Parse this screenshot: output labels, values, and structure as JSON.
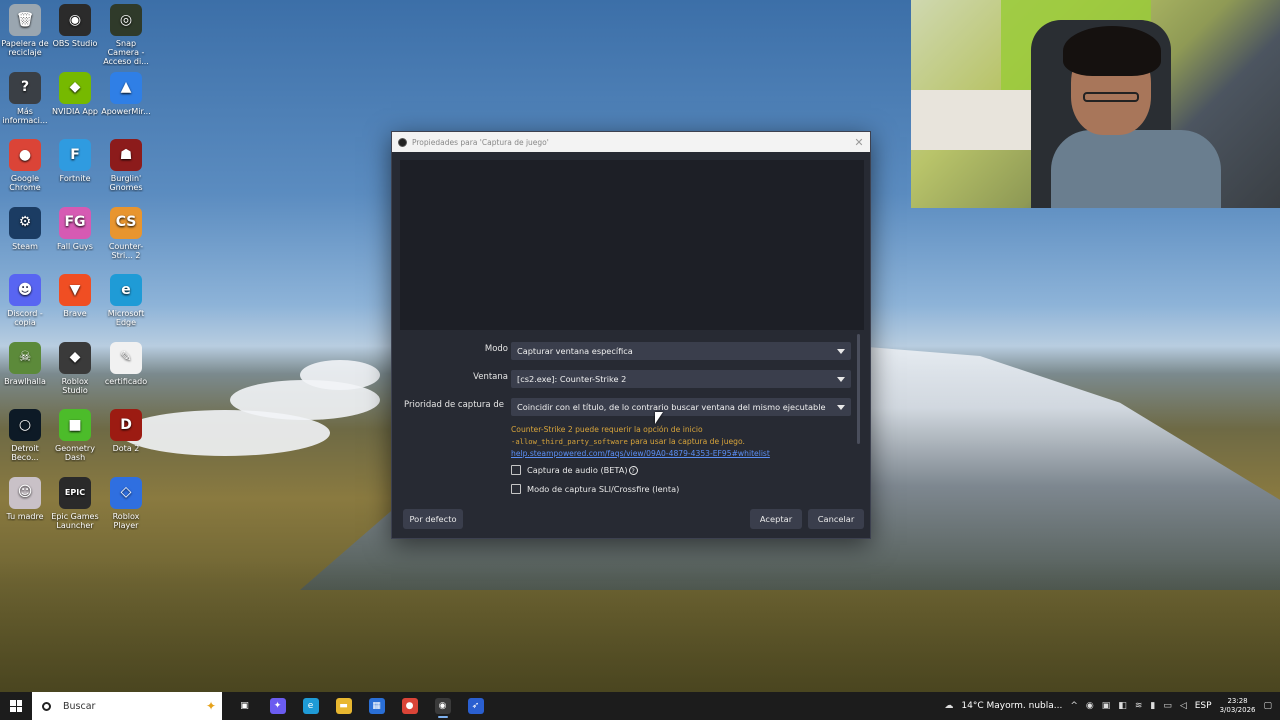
{
  "desktop": {
    "icons": [
      {
        "label": "Papelera de reciclaje",
        "icon": "recycle-bin-icon",
        "color": "#9aa6b0",
        "glyph": "🗑"
      },
      {
        "label": "OBS Studio",
        "icon": "obs-studio-icon",
        "color": "#2b2b2b",
        "glyph": "◉"
      },
      {
        "label": "Snap Camera - Acceso di...",
        "icon": "snap-camera-icon",
        "color": "#2f3a2a",
        "glyph": "◎"
      },
      {
        "label": "Más informaci...",
        "icon": "info-icon",
        "color": "#3a3f45",
        "glyph": "?"
      },
      {
        "label": "NVIDIA App",
        "icon": "nvidia-icon",
        "color": "#76b900",
        "glyph": "◆"
      },
      {
        "label": "ApowerMir...",
        "icon": "apowermirror-icon",
        "color": "#2f7fe6",
        "glyph": "▲"
      },
      {
        "label": "Google Chrome",
        "icon": "chrome-icon",
        "color": "#db4437",
        "glyph": "●"
      },
      {
        "label": "Fortnite",
        "icon": "fortnite-icon",
        "color": "#2f9be0",
        "glyph": "F"
      },
      {
        "label": "Burglin' Gnomes",
        "icon": "burglin-gnomes-icon",
        "color": "#8c1b1b",
        "glyph": "☗"
      },
      {
        "label": "Steam",
        "icon": "steam-icon",
        "color": "#1b3c63",
        "glyph": "⚙"
      },
      {
        "label": "Fall Guys",
        "icon": "fall-guys-icon",
        "color": "#d65ab3",
        "glyph": "FG"
      },
      {
        "label": "Counter-Stri... 2",
        "icon": "counter-strike-icon",
        "color": "#e8952f",
        "glyph": "CS"
      },
      {
        "label": "Discord - copia",
        "icon": "discord-icon",
        "color": "#5865f2",
        "glyph": "☻"
      },
      {
        "label": "Brave",
        "icon": "brave-icon",
        "color": "#f04e23",
        "glyph": "▼"
      },
      {
        "label": "Microsoft Edge",
        "icon": "edge-icon",
        "color": "#1f9bd6",
        "glyph": "e"
      },
      {
        "label": "Brawlhalla",
        "icon": "brawlhalla-icon",
        "color": "#5c8a3a",
        "glyph": "☠"
      },
      {
        "label": "Roblox Studio",
        "icon": "roblox-studio-icon",
        "color": "#3a3a3a",
        "glyph": "◆"
      },
      {
        "label": "certificado",
        "icon": "certificate-icon",
        "color": "#f1f1f1",
        "glyph": "✎"
      },
      {
        "label": "Detroit Beco...",
        "icon": "detroit-icon",
        "color": "#0d1a26",
        "glyph": "○"
      },
      {
        "label": "Geometry Dash",
        "icon": "geometry-dash-icon",
        "color": "#4cbc2a",
        "glyph": "■"
      },
      {
        "label": "Dota 2",
        "icon": "dota2-icon",
        "color": "#9c1b12",
        "glyph": "D"
      },
      {
        "label": "Tu madre",
        "icon": "picture-icon",
        "color": "#c9c1c7",
        "glyph": "☺"
      },
      {
        "label": "Epic Games Launcher",
        "icon": "epic-games-icon",
        "color": "#2a2a2a",
        "glyph": "EPIC"
      },
      {
        "label": "Roblox Player",
        "icon": "roblox-player-icon",
        "color": "#2f6fe0",
        "glyph": "◇"
      }
    ]
  },
  "dialog": {
    "title": "Propiedades para 'Captura de juego'",
    "close_glyph": "✕",
    "mode_label": "Modo",
    "mode_value": "Capturar ventana específica",
    "window_label": "Ventana",
    "window_value": "[cs2.exe]: Counter-Strike 2",
    "priority_label": "Prioridad de captura de ve",
    "priority_value": "Coincidir con el título, de lo contrario buscar ventana del mismo ejecutable",
    "warning_line1": "Counter-Strike 2 puede requerir la opción de inicio",
    "warning_code": "-allow_third_party_software",
    "warning_line2": " para usar la captura de juego.",
    "warning_link": "help.steampowered.com/faqs/view/09A0-4879-4353-EF95#whitelist",
    "audio_capture_label": "Captura de audio (BETA)",
    "help_glyph": "?",
    "sli_label": "Modo de captura SLI/Crossfire (lenta)",
    "defaults_button": "Por defecto",
    "ok_button": "Aceptar",
    "cancel_button": "Cancelar"
  },
  "taskbar": {
    "search_placeholder": "Buscar",
    "apps": [
      {
        "name": "task-view-icon",
        "glyph": "▣",
        "color": "#1c1c1c"
      },
      {
        "name": "copilot-icon",
        "glyph": "✦",
        "color": "#6b5cf0"
      },
      {
        "name": "edge-taskbar-icon",
        "glyph": "e",
        "color": "#1f9bd6"
      },
      {
        "name": "file-explorer-icon",
        "glyph": "▬",
        "color": "#e8b730"
      },
      {
        "name": "store-icon",
        "glyph": "▦",
        "color": "#2a6fd6"
      },
      {
        "name": "chrome-taskbar-icon",
        "glyph": "●",
        "color": "#db4437"
      },
      {
        "name": "obs-taskbar-icon",
        "glyph": "◉",
        "color": "#3a3a3a"
      },
      {
        "name": "rocket-app-icon",
        "glyph": "➶",
        "color": "#2a5fd0"
      }
    ],
    "weather": "14°C  Mayorm. nubla...",
    "language": "ESP",
    "time": "23:28",
    "date": "3/03/2026"
  }
}
